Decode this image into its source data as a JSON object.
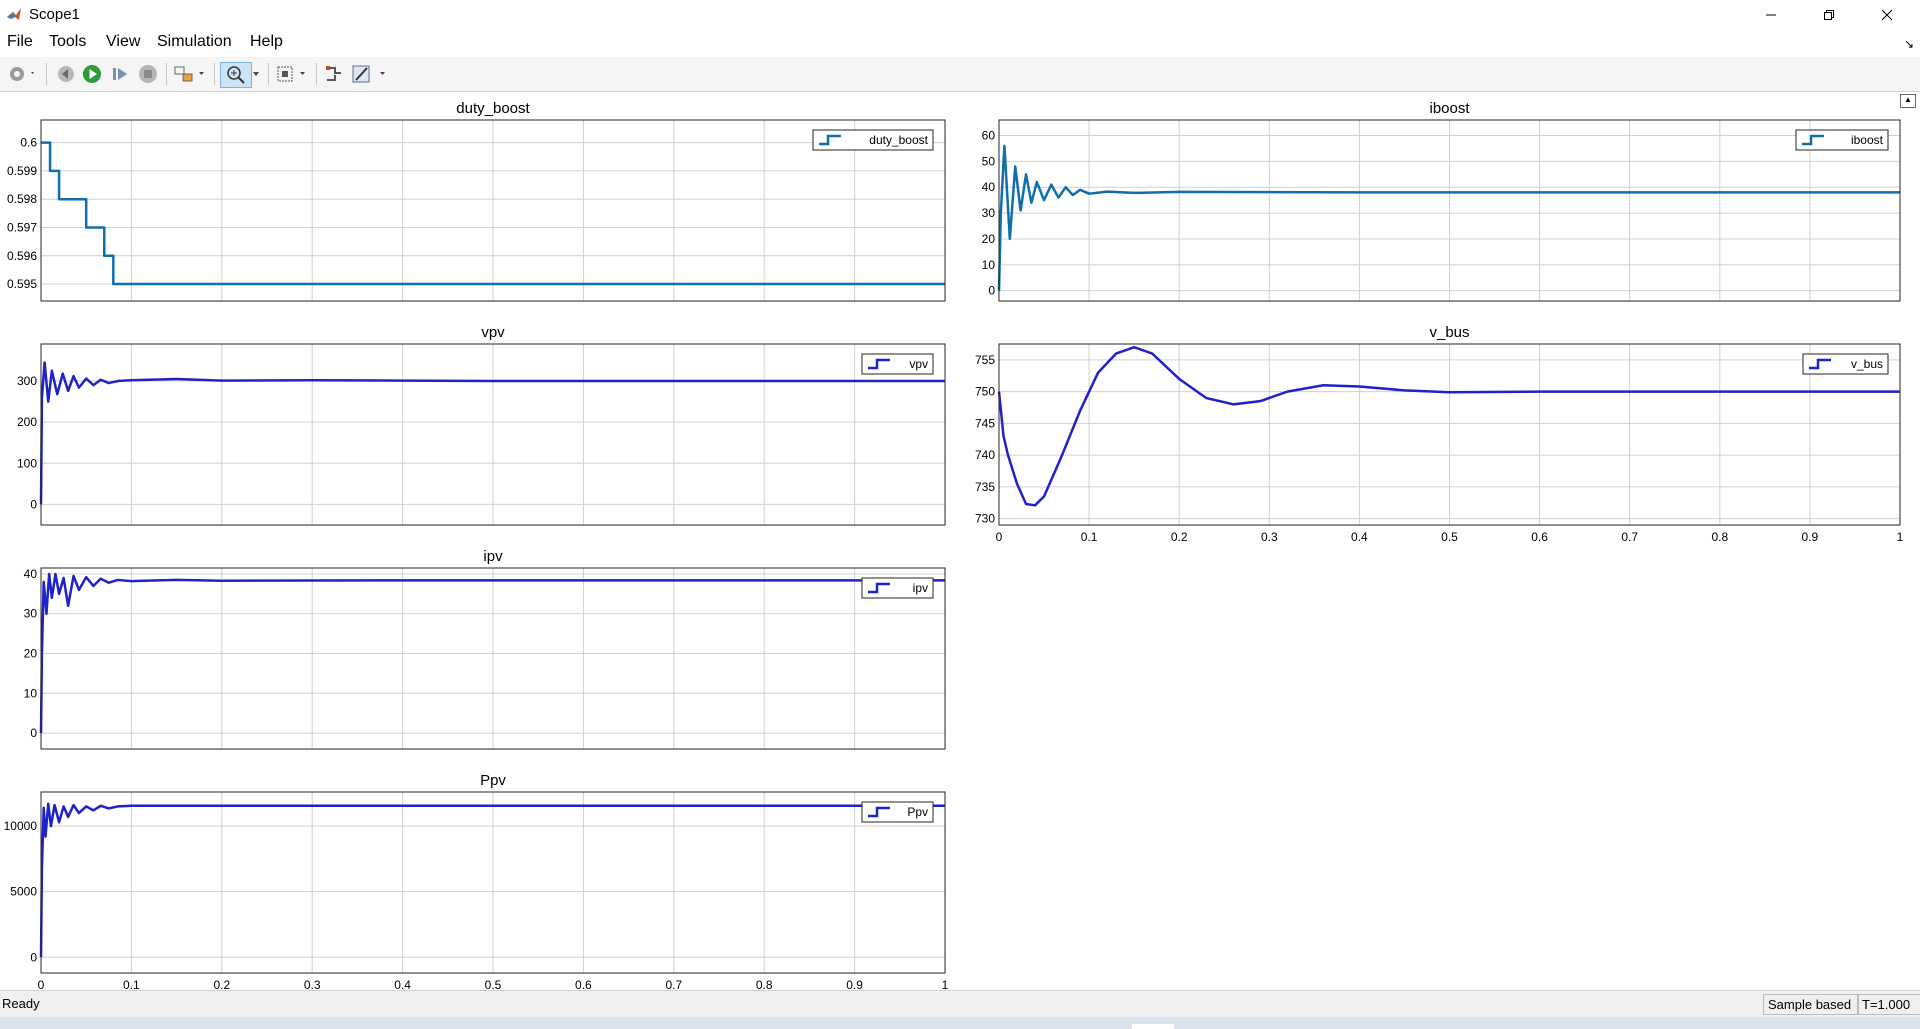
{
  "window": {
    "title": "Scope1"
  },
  "menu": [
    {
      "key": "file",
      "label": "File"
    },
    {
      "key": "tools",
      "label": "Tools"
    },
    {
      "key": "view",
      "label": "View"
    },
    {
      "key": "simulation",
      "label": "Simulation"
    },
    {
      "key": "help",
      "label": "Help"
    }
  ],
  "toolbar": {
    "buttons": [
      "configuration-properties",
      "step-back",
      "run",
      "step-forward",
      "stop",
      "highlight-block",
      "zoom-in",
      "fit-to-view",
      "signal-selector",
      "measurement-tools"
    ],
    "active": "zoom-in"
  },
  "status": {
    "text": "Ready",
    "mode": "Sample based",
    "time": "T=1.000"
  },
  "colors": {
    "series_teal": "#0f6fad",
    "series_blue": "#1f22c8",
    "grid": "#d0d0d0",
    "axes": "#262626"
  },
  "chart_data": [
    {
      "type": "line",
      "title": "duty_boost",
      "xlim": [
        0,
        1
      ],
      "ylim": [
        0.5944,
        0.6008
      ],
      "yticks": [
        0.6,
        0.599,
        0.598,
        0.597,
        0.596,
        0.595
      ],
      "xticks": [
        0,
        0.1,
        0.2,
        0.3,
        0.4,
        0.5,
        0.6,
        0.7,
        0.8,
        0.9,
        1
      ],
      "show_xtick_labels": false,
      "grid": true,
      "legend": "top-right",
      "series": [
        {
          "name": "duty_boost",
          "color": "#0f6fad",
          "step": true,
          "x": [
            0,
            0.01,
            0.02,
            0.05,
            0.07,
            0.08,
            1
          ],
          "y": [
            0.6,
            0.599,
            0.598,
            0.597,
            0.596,
            0.595,
            0.595
          ]
        }
      ]
    },
    {
      "type": "line",
      "title": "iboost",
      "xlim": [
        0,
        1
      ],
      "ylim": [
        -4,
        66
      ],
      "yticks": [
        60,
        50,
        40,
        30,
        20,
        10,
        0
      ],
      "xticks": [
        0,
        0.1,
        0.2,
        0.3,
        0.4,
        0.5,
        0.6,
        0.7,
        0.8,
        0.9,
        1
      ],
      "show_xtick_labels": false,
      "grid": true,
      "legend": "top-right",
      "series": [
        {
          "name": "iboost",
          "color": "#0f6fad",
          "x": [
            0,
            0.002,
            0.006,
            0.012,
            0.018,
            0.024,
            0.03,
            0.036,
            0.042,
            0.05,
            0.058,
            0.066,
            0.074,
            0.082,
            0.09,
            0.1,
            0.12,
            0.15,
            0.2,
            0.4,
            0.6,
            0.8,
            1
          ],
          "y": [
            0,
            30,
            56,
            20,
            48,
            31,
            45,
            34,
            42,
            35,
            41,
            36,
            40,
            37,
            39,
            37.5,
            38.3,
            37.8,
            38.2,
            38,
            38,
            38,
            38
          ]
        }
      ]
    },
    {
      "type": "line",
      "title": "vpv",
      "xlim": [
        0,
        1
      ],
      "ylim": [
        -50,
        390
      ],
      "yticks": [
        300,
        200,
        100,
        0
      ],
      "xticks": [
        0,
        0.1,
        0.2,
        0.3,
        0.4,
        0.5,
        0.6,
        0.7,
        0.8,
        0.9,
        1
      ],
      "show_xtick_labels": false,
      "grid": true,
      "legend": "top-right",
      "series": [
        {
          "name": "vpv",
          "color": "#1f22c8",
          "x": [
            0,
            0.001,
            0.004,
            0.008,
            0.012,
            0.018,
            0.024,
            0.03,
            0.036,
            0.042,
            0.05,
            0.058,
            0.066,
            0.075,
            0.085,
            0.1,
            0.15,
            0.2,
            0.3,
            0.4,
            0.5,
            0.7,
            1
          ],
          "y": [
            0,
            260,
            345,
            250,
            325,
            268,
            318,
            276,
            312,
            284,
            306,
            290,
            303,
            295,
            300,
            302,
            305,
            301,
            302,
            301,
            300,
            300,
            300
          ]
        }
      ]
    },
    {
      "type": "line",
      "title": "v_bus",
      "xlim": [
        0,
        1
      ],
      "ylim": [
        729,
        757.5
      ],
      "yticks": [
        755,
        750,
        745,
        740,
        735,
        730
      ],
      "xticks": [
        0,
        0.1,
        0.2,
        0.3,
        0.4,
        0.5,
        0.6,
        0.7,
        0.8,
        0.9,
        1
      ],
      "xtick_labels": [
        "0",
        "0.1",
        "0.2",
        "0.3",
        "0.4",
        "0.5",
        "0.6",
        "0.7",
        "0.8",
        "0.9",
        "1"
      ],
      "show_xtick_labels": true,
      "grid": true,
      "legend": "top-right",
      "series": [
        {
          "name": "v_bus",
          "color": "#1f22c8",
          "x": [
            0,
            0.005,
            0.01,
            0.02,
            0.03,
            0.04,
            0.05,
            0.07,
            0.09,
            0.11,
            0.13,
            0.15,
            0.17,
            0.2,
            0.23,
            0.26,
            0.29,
            0.32,
            0.36,
            0.4,
            0.45,
            0.5,
            0.6,
            0.7,
            0.8,
            0.9,
            1
          ],
          "y": [
            750,
            743,
            740,
            735.5,
            732.3,
            732.1,
            733.5,
            740,
            747,
            753,
            756,
            757,
            756,
            752,
            749,
            748,
            748.5,
            750,
            751,
            750.8,
            750.2,
            749.9,
            750,
            750,
            750,
            750,
            750
          ]
        }
      ]
    },
    {
      "type": "line",
      "title": "ipv",
      "xlim": [
        0,
        1
      ],
      "ylim": [
        -4,
        41.5
      ],
      "yticks": [
        40,
        30,
        20,
        10,
        0
      ],
      "xticks": [
        0,
        0.1,
        0.2,
        0.3,
        0.4,
        0.5,
        0.6,
        0.7,
        0.8,
        0.9,
        1
      ],
      "show_xtick_labels": false,
      "grid": true,
      "legend": "top-right",
      "series": [
        {
          "name": "ipv",
          "color": "#1f22c8",
          "x": [
            0,
            0.001,
            0.003,
            0.006,
            0.009,
            0.012,
            0.016,
            0.02,
            0.025,
            0.03,
            0.036,
            0.042,
            0.05,
            0.058,
            0.066,
            0.075,
            0.085,
            0.1,
            0.15,
            0.2,
            0.4,
            0.7,
            1
          ],
          "y": [
            0,
            20,
            38,
            30,
            40,
            34,
            40,
            35,
            39,
            32,
            39.5,
            36,
            39.2,
            37,
            38.8,
            37.8,
            38.5,
            38.2,
            38.5,
            38.3,
            38.4,
            38.4,
            38.4
          ]
        }
      ]
    },
    {
      "type": "line",
      "title": "Ppv",
      "xlim": [
        0,
        1
      ],
      "ylim": [
        -1200,
        12600
      ],
      "yticks": [
        10000,
        5000,
        0
      ],
      "xticks": [
        0,
        0.1,
        0.2,
        0.3,
        0.4,
        0.5,
        0.6,
        0.7,
        0.8,
        0.9,
        1
      ],
      "xtick_labels": [
        "0",
        "0.1",
        "0.2",
        "0.3",
        "0.4",
        "0.5",
        "0.6",
        "0.7",
        "0.8",
        "0.9",
        "1"
      ],
      "show_xtick_labels": true,
      "grid": true,
      "legend": "top-right",
      "series": [
        {
          "name": "Ppv",
          "color": "#1f22c8",
          "x": [
            0,
            0.001,
            0.003,
            0.005,
            0.008,
            0.011,
            0.015,
            0.02,
            0.025,
            0.03,
            0.036,
            0.042,
            0.05,
            0.058,
            0.066,
            0.075,
            0.085,
            0.1,
            0.15,
            0.3,
            0.5,
            0.7,
            1
          ],
          "y": [
            0,
            6800,
            11400,
            9200,
            11700,
            10000,
            11600,
            10300,
            11500,
            10700,
            11600,
            11000,
            11500,
            11200,
            11550,
            11350,
            11500,
            11550,
            11550,
            11550,
            11550,
            11550,
            11550
          ]
        }
      ]
    }
  ]
}
